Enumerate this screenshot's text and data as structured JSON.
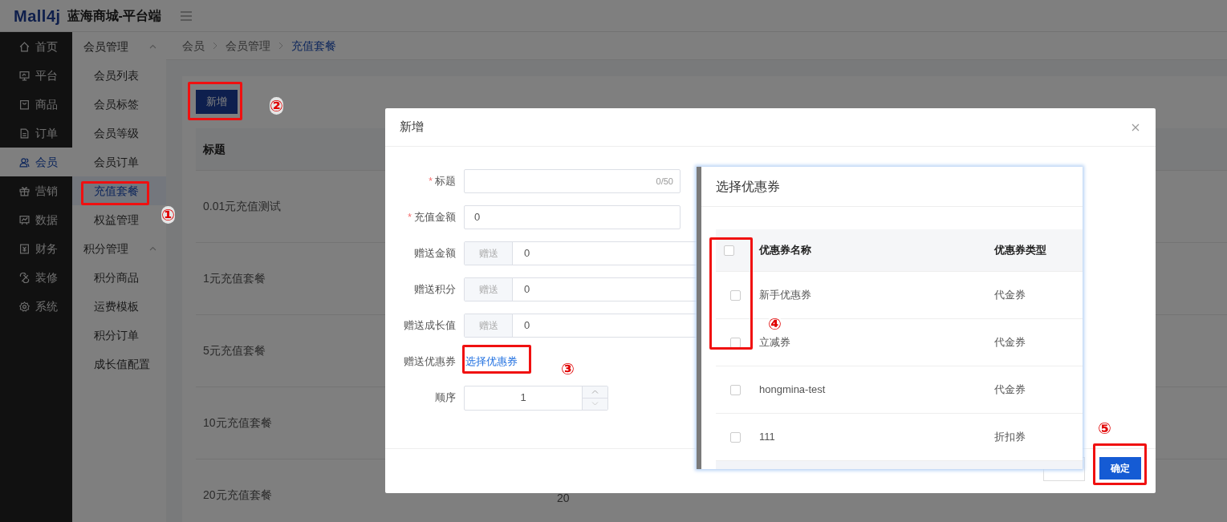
{
  "header": {
    "logo": "Mall4j",
    "title": "蓝海商城-平台端"
  },
  "main_nav": [
    {
      "label": "首页",
      "selected": false
    },
    {
      "label": "平台",
      "selected": false
    },
    {
      "label": "商品",
      "selected": false
    },
    {
      "label": "订单",
      "selected": false
    },
    {
      "label": "会员",
      "selected": true
    },
    {
      "label": "营销",
      "selected": false
    },
    {
      "label": "数据",
      "selected": false
    },
    {
      "label": "财务",
      "selected": false
    },
    {
      "label": "装修",
      "selected": false
    },
    {
      "label": "系统",
      "selected": false
    }
  ],
  "sub_nav": [
    {
      "label": "会员管理",
      "expanded": true,
      "children": [
        {
          "label": "会员列表",
          "selected": false
        },
        {
          "label": "会员标签",
          "selected": false
        },
        {
          "label": "会员等级",
          "selected": false
        },
        {
          "label": "会员订单",
          "selected": false
        },
        {
          "label": "充值套餐",
          "selected": true
        },
        {
          "label": "权益管理",
          "selected": false
        }
      ]
    },
    {
      "label": "积分管理",
      "expanded": true,
      "children": [
        {
          "label": "积分商品",
          "selected": false
        },
        {
          "label": "运费模板",
          "selected": false
        },
        {
          "label": "积分订单",
          "selected": false
        },
        {
          "label": "成长值配置",
          "selected": false
        }
      ]
    }
  ],
  "breadcrumb": [
    {
      "label": "会员",
      "current": false
    },
    {
      "label": "会员管理",
      "current": false
    },
    {
      "label": "充值套餐",
      "current": true
    }
  ],
  "page": {
    "add_button": "新增",
    "table": {
      "columns": [
        "标题"
      ],
      "rows": [
        {
          "title": "0.01元充值测试"
        },
        {
          "title": "1元充值套餐"
        },
        {
          "title": "5元充值套餐"
        },
        {
          "title": "10元充值套餐"
        },
        {
          "title": "20元充值套餐",
          "column_2": "20"
        }
      ]
    }
  },
  "dialog": {
    "title": "新增",
    "fields": [
      {
        "kind": "text",
        "label": "标题",
        "required_mark": "*",
        "counter": "0/50"
      },
      {
        "kind": "text",
        "label": "充值金额",
        "required_mark": "*",
        "value": "0"
      },
      {
        "kind": "prepend",
        "label": "赠送金额",
        "prepend": "赠送",
        "value": "0"
      },
      {
        "kind": "prepend",
        "label": "赠送积分",
        "prepend": "赠送",
        "value": "0"
      },
      {
        "kind": "prepend",
        "label": "赠送成长值",
        "prepend": "赠送",
        "value": "0"
      },
      {
        "kind": "link",
        "label": "赠送优惠券",
        "link": "选择优惠券"
      },
      {
        "kind": "number",
        "label": "顺序",
        "value": "1"
      }
    ],
    "confirm_button": "确定"
  },
  "coupon_picker": {
    "title": "选择优惠券",
    "columns": [
      "优惠券名称",
      "优惠券类型"
    ],
    "all_checked": false,
    "rows": [
      {
        "name": "新手优惠券",
        "type": "代金券",
        "checked": false
      },
      {
        "name": "立减券",
        "type": "代金券",
        "checked": false
      },
      {
        "name": "hongmina-test",
        "type": "代金券",
        "checked": false
      },
      {
        "name": "111",
        "type": "折扣券",
        "checked": false
      }
    ]
  },
  "annotations": [
    "①",
    "②",
    "③",
    "④",
    "⑤"
  ]
}
